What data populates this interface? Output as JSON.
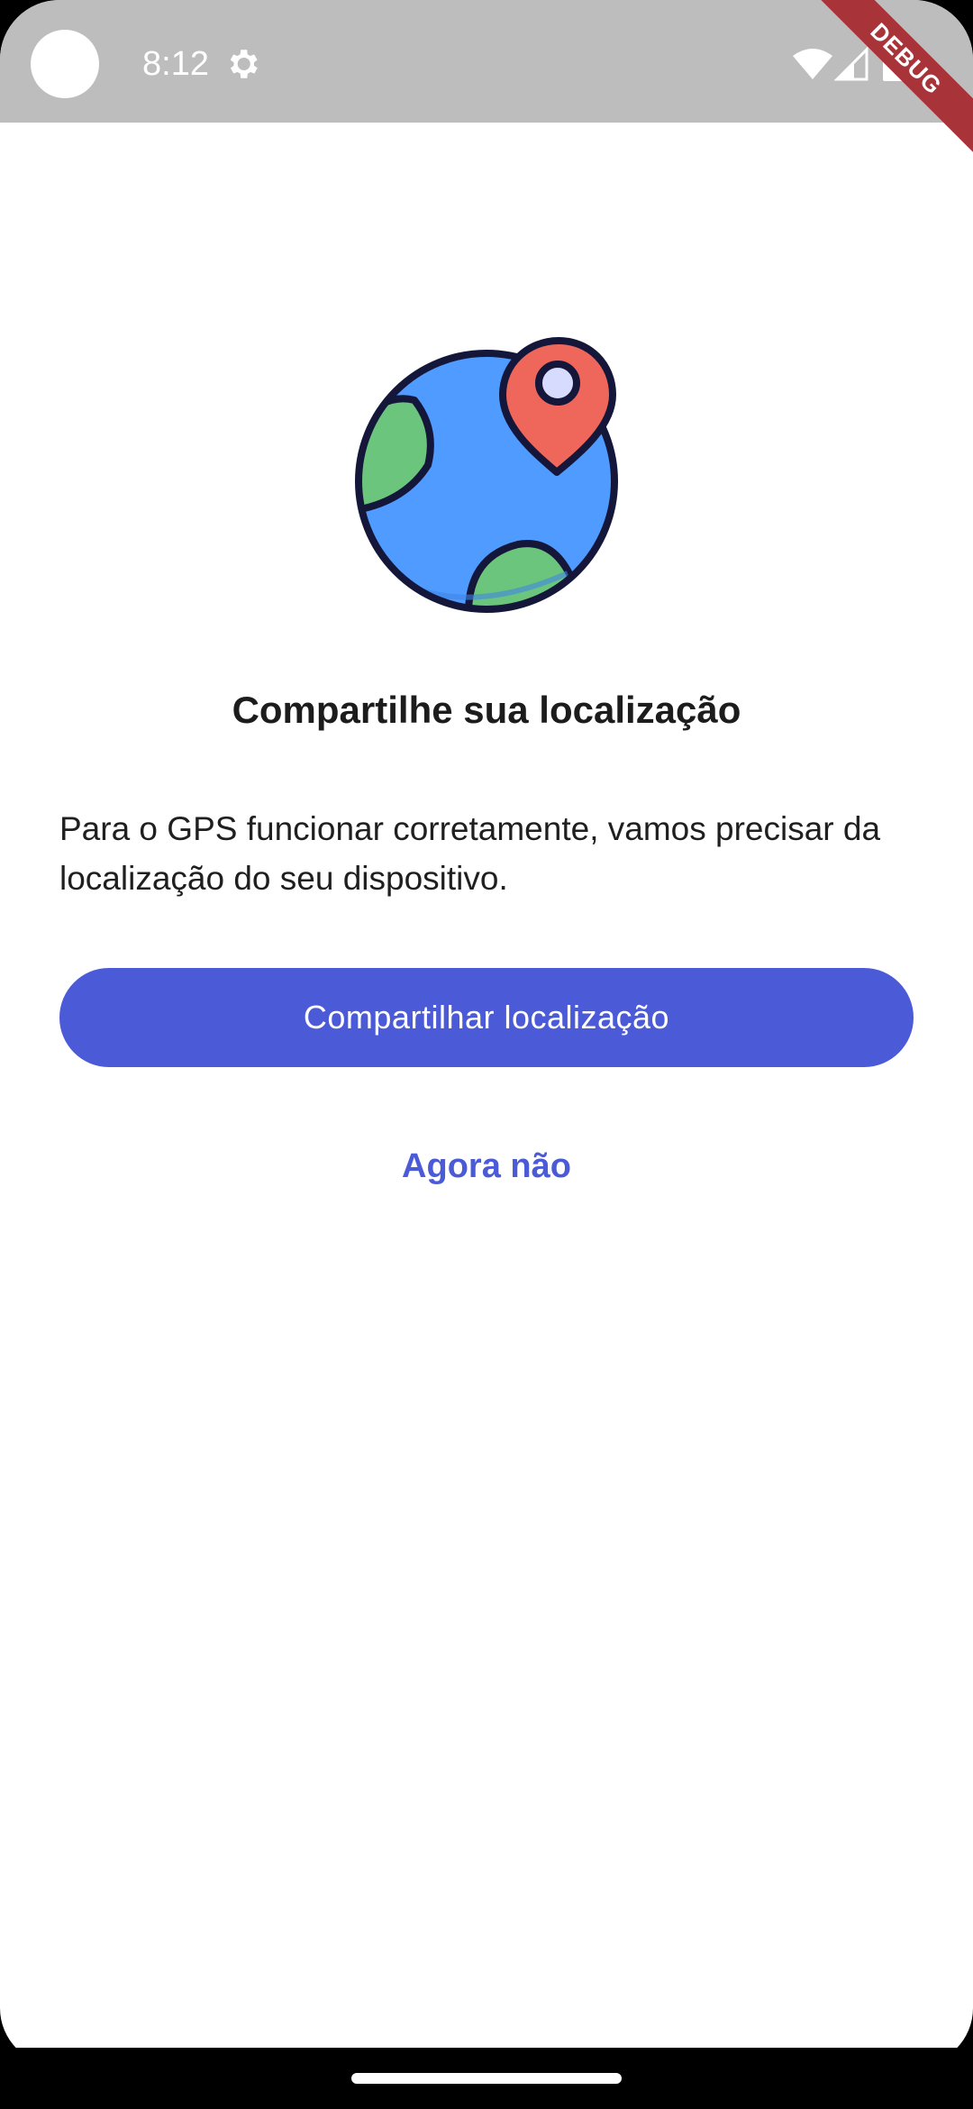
{
  "status_bar": {
    "time": "8:12",
    "icons": [
      "settings-icon",
      "wifi-icon",
      "signal-icon",
      "battery-icon"
    ]
  },
  "debug_banner": "DEBUG",
  "illustration": "globe-location-pin-icon",
  "content": {
    "title": "Compartilhe sua localização",
    "description": "Para o GPS funcionar corretamente, vamos precisar da localização do seu dispositivo.",
    "primary_button": "Compartilhar localização",
    "secondary_link": "Agora não"
  },
  "colors": {
    "accent": "#4b5bd8",
    "status_bar": "#bdbdbd",
    "debug_ribbon": "#a8343a",
    "globe_ocean": "#4f9bff",
    "globe_land": "#6cc57c",
    "pin": "#ef675b"
  }
}
